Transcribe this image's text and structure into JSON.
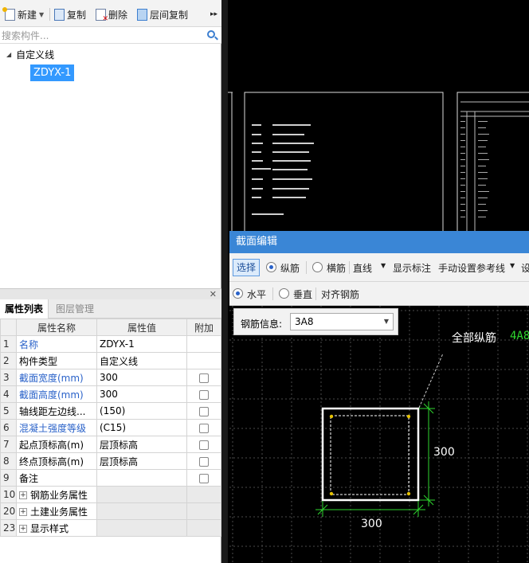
{
  "toolbar": {
    "new_label": "新建",
    "copy_label": "复制",
    "delete_label": "删除",
    "floor_copy_label": "层间复制"
  },
  "search": {
    "placeholder": "搜索构件..."
  },
  "tree": {
    "root_label": "自定义线",
    "selected_item": "ZDYX-1"
  },
  "tabs": {
    "properties": "属性列表",
    "layers": "图层管理"
  },
  "props_table": {
    "headers": [
      "属性名称",
      "属性值",
      "附加"
    ],
    "rows": [
      {
        "num": "1",
        "name": "名称",
        "value": "ZDYX-1",
        "blue": true,
        "check": false
      },
      {
        "num": "2",
        "name": "构件类型",
        "value": "自定义线",
        "blue": false,
        "check": false
      },
      {
        "num": "3",
        "name": "截面宽度(mm)",
        "value": "300",
        "blue": true,
        "check": true
      },
      {
        "num": "4",
        "name": "截面高度(mm)",
        "value": "300",
        "blue": true,
        "check": true
      },
      {
        "num": "5",
        "name": "轴线距左边线...",
        "value": "(150)",
        "blue": false,
        "check": true
      },
      {
        "num": "6",
        "name": "混凝土强度等级",
        "value": "(C15)",
        "blue": true,
        "check": true
      },
      {
        "num": "7",
        "name": "起点顶标高(m)",
        "value": "层顶标高",
        "blue": false,
        "check": true
      },
      {
        "num": "8",
        "name": "终点顶标高(m)",
        "value": "层顶标高",
        "blue": false,
        "check": true
      },
      {
        "num": "9",
        "name": "备注",
        "value": "",
        "blue": false,
        "check": true
      }
    ],
    "groups": [
      {
        "num": "10",
        "name": "钢筋业务属性"
      },
      {
        "num": "20",
        "name": "土建业务属性"
      },
      {
        "num": "23",
        "name": "显示样式"
      }
    ]
  },
  "dialog": {
    "title": "截面编辑",
    "select_label": "选择",
    "longitudinal_label": "纵筋",
    "transverse_label": "横筋",
    "line_label": "直线",
    "show_dim_label": "显示标注",
    "manual_ref_label": "手动设置参考线",
    "truncated_label": "设",
    "horizontal_label": "水平",
    "vertical_label": "垂直",
    "align_label": "对齐钢筋",
    "rebar_info_label": "钢筋信息:",
    "rebar_info_value": "3A8",
    "all_long_label": "全部纵筋",
    "all_long_value": "4A8",
    "dim_height": "300",
    "dim_width": "300"
  },
  "colors": {
    "accent_blue": "#3a86d6",
    "dim_green": "#2fd62f",
    "selection_blue": "#3399ff"
  }
}
